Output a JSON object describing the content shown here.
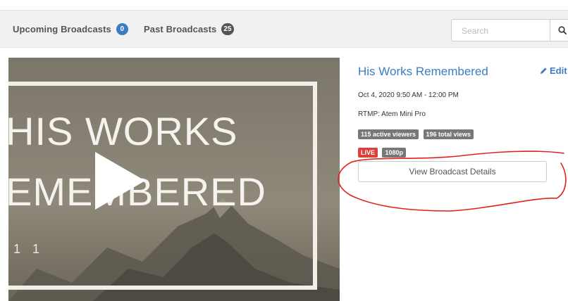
{
  "tabs": {
    "upcoming_label": "Upcoming Broadcasts",
    "upcoming_count": "0",
    "past_label": "Past Broadcasts",
    "past_count": "25"
  },
  "search": {
    "placeholder": "Search",
    "icon": "magnifier-icon"
  },
  "broadcast": {
    "thumbnail_line1": "HIS WORKS",
    "thumbnail_line2": "EMEMBERED",
    "thumbnail_foot": "1 1",
    "title": "His Works Remembered",
    "edit_label": "Edit",
    "edit_icon": "pencil-icon",
    "date": "Oct 4, 2020 9:50 AM - 12:00 PM",
    "source": "RTMP: Atem Mini Pro",
    "active_viewers": "115 active viewers",
    "total_views": "196 total views",
    "live_label": "LIVE",
    "resolution": "1080p",
    "details_button": "View Broadcast Details"
  },
  "colors": {
    "accent": "#3b7cc6",
    "live": "#d9413b",
    "tag_gray": "#777777",
    "annotation": "#e0211a"
  }
}
